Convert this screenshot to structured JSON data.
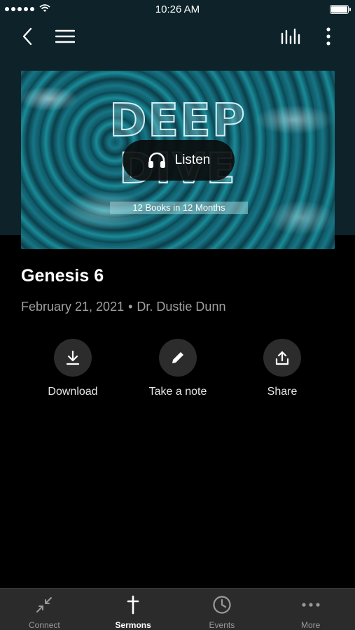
{
  "status_bar": {
    "time": "10:26 AM"
  },
  "hero": {
    "title_line1": "DEEP",
    "title_line2": "DIVE",
    "subtitle": "12 Books in 12 Months",
    "listen_label": "Listen"
  },
  "sermon": {
    "title": "Genesis 6",
    "date": "February 21, 2021",
    "separator": "•",
    "speaker": "Dr. Dustie Dunn"
  },
  "actions": [
    {
      "label": "Download",
      "icon": "download-icon"
    },
    {
      "label": "Take a note",
      "icon": "pencil-icon"
    },
    {
      "label": "Share",
      "icon": "share-icon"
    }
  ],
  "tabs": [
    {
      "label": "Connect",
      "icon": "connect-icon",
      "active": false
    },
    {
      "label": "Sermons",
      "icon": "cross-icon",
      "active": true
    },
    {
      "label": "Events",
      "icon": "clock-icon",
      "active": false
    },
    {
      "label": "More",
      "icon": "more-dots-icon",
      "active": false
    }
  ],
  "colors": {
    "background": "#000000",
    "header": "#0d2229",
    "tabbar": "#2b2b2b",
    "muted_text": "#a0a0a0"
  }
}
